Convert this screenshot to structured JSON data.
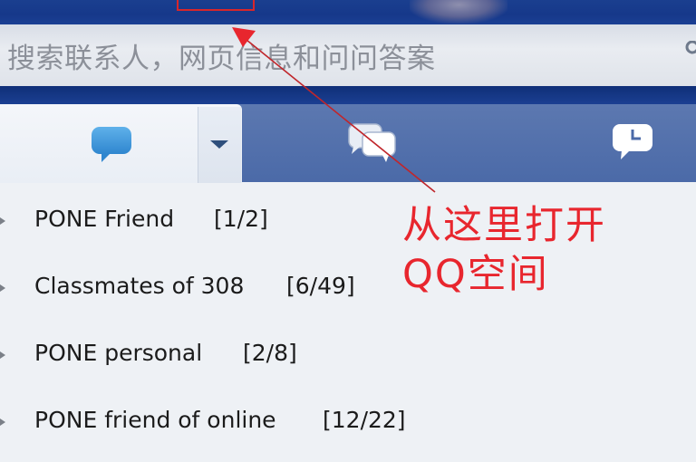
{
  "search": {
    "placeholder": "搜索联系人，网页信息和问问答案"
  },
  "tabs": [
    {
      "name": "contacts",
      "icon": "chat-bubble-icon",
      "active": true
    },
    {
      "name": "groups",
      "icon": "group-chat-icon",
      "active": false
    },
    {
      "name": "recent",
      "icon": "recent-chat-icon",
      "active": false
    }
  ],
  "groups": [
    {
      "label": "PONE Friend",
      "count": "[1/2]"
    },
    {
      "label": "Classmates of 308",
      "count": "[6/49]"
    },
    {
      "label": "PONE personal",
      "count": "[2/8]"
    },
    {
      "label": "PONE friend of online",
      "count": "[12/22]"
    }
  ],
  "annotation": {
    "line1": "从这里打开",
    "line2": "QQ空间"
  },
  "colors": {
    "banner": "#1a3f8f",
    "tab_strip": "#5474ae",
    "annotation": "#e8262e",
    "list_background": "#eef1f5"
  }
}
